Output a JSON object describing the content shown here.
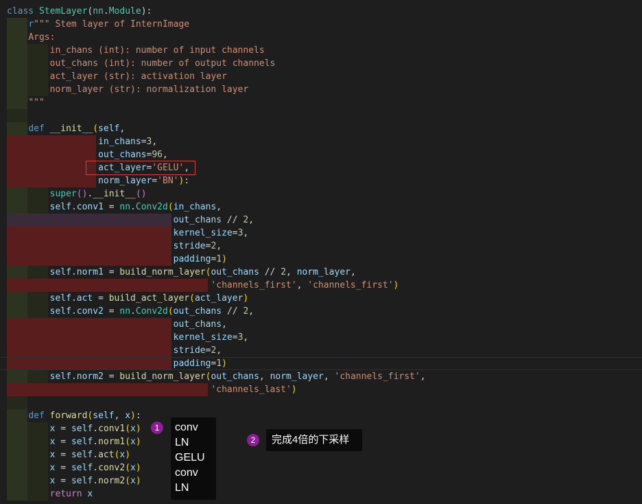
{
  "code": {
    "lines": [
      [
        [
          "tok-kw",
          "class "
        ],
        [
          "tok-cls",
          "StemLayer"
        ],
        [
          "tok-op",
          "("
        ],
        [
          "tok-cls",
          "nn"
        ],
        [
          "tok-op",
          "."
        ],
        [
          "tok-cls",
          "Module"
        ],
        [
          "tok-op",
          "):"
        ]
      ],
      [
        [
          "tok-sp",
          "    "
        ],
        [
          "tok-kw",
          "r"
        ],
        [
          "tok-str",
          "\"\"\" Stem layer of InternImage"
        ]
      ],
      [
        [
          "tok-sp",
          "    "
        ],
        [
          "tok-str",
          "Args:"
        ]
      ],
      [
        [
          "tok-sp",
          "        "
        ],
        [
          "tok-str",
          "in_chans (int): number of input channels"
        ]
      ],
      [
        [
          "tok-sp",
          "        "
        ],
        [
          "tok-str",
          "out_chans (int): number of output channels"
        ]
      ],
      [
        [
          "tok-sp",
          "        "
        ],
        [
          "tok-str",
          "act_layer (str): activation layer"
        ]
      ],
      [
        [
          "tok-sp",
          "        "
        ],
        [
          "tok-str",
          "norm_layer (str): normalization layer"
        ]
      ],
      [
        [
          "tok-sp",
          "    "
        ],
        [
          "tok-str",
          "\"\"\""
        ]
      ],
      [],
      [
        [
          "tok-sp",
          "    "
        ],
        [
          "tok-kw",
          "def "
        ],
        [
          "tok-fn",
          "__init__"
        ],
        [
          "tok-paren",
          "("
        ],
        [
          "tok-var",
          "self"
        ],
        [
          "tok-op",
          ","
        ]
      ],
      [
        [
          "tok-sp",
          "                 "
        ],
        [
          "tok-var",
          "in_chans"
        ],
        [
          "tok-op",
          "="
        ],
        [
          "tok-num",
          "3"
        ],
        [
          "tok-op",
          ","
        ]
      ],
      [
        [
          "tok-sp",
          "                 "
        ],
        [
          "tok-var",
          "out_chans"
        ],
        [
          "tok-op",
          "="
        ],
        [
          "tok-num",
          "96"
        ],
        [
          "tok-op",
          ","
        ]
      ],
      [
        [
          "tok-sp",
          "                 "
        ],
        [
          "tok-var",
          "act_layer"
        ],
        [
          "tok-op",
          "="
        ],
        [
          "tok-str",
          "'GELU'"
        ],
        [
          "tok-op",
          ","
        ]
      ],
      [
        [
          "tok-sp",
          "                 "
        ],
        [
          "tok-var",
          "norm_layer"
        ],
        [
          "tok-op",
          "="
        ],
        [
          "tok-str",
          "'BN'"
        ],
        [
          "tok-paren",
          ")"
        ],
        [
          "tok-op",
          ":"
        ]
      ],
      [
        [
          "tok-sp",
          "        "
        ],
        [
          "tok-cls",
          "super"
        ],
        [
          "tok-paren2",
          "()"
        ],
        [
          "tok-op",
          "."
        ],
        [
          "tok-fn",
          "__init__"
        ],
        [
          "tok-paren2",
          "()"
        ]
      ],
      [
        [
          "tok-sp",
          "        "
        ],
        [
          "tok-var",
          "self"
        ],
        [
          "tok-op",
          "."
        ],
        [
          "tok-var",
          "conv1"
        ],
        [
          "tok-op",
          " = "
        ],
        [
          "tok-cls",
          "nn"
        ],
        [
          "tok-op",
          "."
        ],
        [
          "tok-cls",
          "Conv2d"
        ],
        [
          "tok-paren",
          "("
        ],
        [
          "tok-var",
          "in_chans"
        ],
        [
          "tok-op",
          ","
        ]
      ],
      [
        [
          "tok-sp",
          "                               "
        ],
        [
          "tok-var",
          "out_chans"
        ],
        [
          "tok-op",
          " // "
        ],
        [
          "tok-num",
          "2"
        ],
        [
          "tok-op",
          ","
        ]
      ],
      [
        [
          "tok-sp",
          "                               "
        ],
        [
          "tok-var",
          "kernel_size"
        ],
        [
          "tok-op",
          "="
        ],
        [
          "tok-num",
          "3"
        ],
        [
          "tok-op",
          ","
        ]
      ],
      [
        [
          "tok-sp",
          "                               "
        ],
        [
          "tok-var",
          "stride"
        ],
        [
          "tok-op",
          "="
        ],
        [
          "tok-num",
          "2"
        ],
        [
          "tok-op",
          ","
        ]
      ],
      [
        [
          "tok-sp",
          "                               "
        ],
        [
          "tok-var",
          "padding"
        ],
        [
          "tok-op",
          "="
        ],
        [
          "tok-num",
          "1"
        ],
        [
          "tok-paren",
          ")"
        ]
      ],
      [
        [
          "tok-sp",
          "        "
        ],
        [
          "tok-var",
          "self"
        ],
        [
          "tok-op",
          "."
        ],
        [
          "tok-var",
          "norm1"
        ],
        [
          "tok-op",
          " = "
        ],
        [
          "tok-fn",
          "build_norm_layer"
        ],
        [
          "tok-paren",
          "("
        ],
        [
          "tok-var",
          "out_chans"
        ],
        [
          "tok-op",
          " // "
        ],
        [
          "tok-num",
          "2"
        ],
        [
          "tok-op",
          ", "
        ],
        [
          "tok-var",
          "norm_layer"
        ],
        [
          "tok-op",
          ","
        ]
      ],
      [
        [
          "tok-sp",
          "                                      "
        ],
        [
          "tok-str",
          "'channels_first'"
        ],
        [
          "tok-op",
          ", "
        ],
        [
          "tok-str",
          "'channels_first'"
        ],
        [
          "tok-paren",
          ")"
        ]
      ],
      [
        [
          "tok-sp",
          "        "
        ],
        [
          "tok-var",
          "self"
        ],
        [
          "tok-op",
          "."
        ],
        [
          "tok-var",
          "act"
        ],
        [
          "tok-op",
          " = "
        ],
        [
          "tok-fn",
          "build_act_layer"
        ],
        [
          "tok-paren",
          "("
        ],
        [
          "tok-var",
          "act_layer"
        ],
        [
          "tok-paren",
          ")"
        ]
      ],
      [
        [
          "tok-sp",
          "        "
        ],
        [
          "tok-var",
          "self"
        ],
        [
          "tok-op",
          "."
        ],
        [
          "tok-var",
          "conv2"
        ],
        [
          "tok-op",
          " = "
        ],
        [
          "tok-cls",
          "nn"
        ],
        [
          "tok-op",
          "."
        ],
        [
          "tok-cls",
          "Conv2d"
        ],
        [
          "tok-paren",
          "("
        ],
        [
          "tok-var",
          "out_chans"
        ],
        [
          "tok-op",
          " // "
        ],
        [
          "tok-num",
          "2"
        ],
        [
          "tok-op",
          ","
        ]
      ],
      [
        [
          "tok-sp",
          "                               "
        ],
        [
          "tok-var",
          "out_chans"
        ],
        [
          "tok-op",
          ","
        ]
      ],
      [
        [
          "tok-sp",
          "                               "
        ],
        [
          "tok-var",
          "kernel_size"
        ],
        [
          "tok-op",
          "="
        ],
        [
          "tok-num",
          "3"
        ],
        [
          "tok-op",
          ","
        ]
      ],
      [
        [
          "tok-sp",
          "                               "
        ],
        [
          "tok-var",
          "stride"
        ],
        [
          "tok-op",
          "="
        ],
        [
          "tok-num",
          "2"
        ],
        [
          "tok-op",
          ","
        ]
      ],
      [
        [
          "tok-sp",
          "                               "
        ],
        [
          "tok-var",
          "padding"
        ],
        [
          "tok-op",
          "="
        ],
        [
          "tok-num",
          "1"
        ],
        [
          "tok-paren",
          ")"
        ]
      ],
      [
        [
          "tok-sp",
          "        "
        ],
        [
          "tok-var",
          "self"
        ],
        [
          "tok-op",
          "."
        ],
        [
          "tok-var",
          "norm2"
        ],
        [
          "tok-op",
          " = "
        ],
        [
          "tok-fn",
          "build_norm_layer"
        ],
        [
          "tok-paren",
          "("
        ],
        [
          "tok-var",
          "out_chans"
        ],
        [
          "tok-op",
          ", "
        ],
        [
          "tok-var",
          "norm_layer"
        ],
        [
          "tok-op",
          ", "
        ],
        [
          "tok-str",
          "'channels_first'"
        ],
        [
          "tok-op",
          ","
        ]
      ],
      [
        [
          "tok-sp",
          "                                      "
        ],
        [
          "tok-str",
          "'channels_last'"
        ],
        [
          "tok-paren",
          ")"
        ]
      ],
      [],
      [
        [
          "tok-sp",
          "    "
        ],
        [
          "tok-kw",
          "def "
        ],
        [
          "tok-fn",
          "forward"
        ],
        [
          "tok-paren",
          "("
        ],
        [
          "tok-var",
          "self"
        ],
        [
          "tok-op",
          ", "
        ],
        [
          "tok-var",
          "x"
        ],
        [
          "tok-paren",
          ")"
        ],
        [
          "tok-op",
          ":"
        ]
      ],
      [
        [
          "tok-sp",
          "        "
        ],
        [
          "tok-var",
          "x"
        ],
        [
          "tok-op",
          " = "
        ],
        [
          "tok-var",
          "self"
        ],
        [
          "tok-op",
          "."
        ],
        [
          "tok-fn",
          "conv1"
        ],
        [
          "tok-paren",
          "("
        ],
        [
          "tok-var",
          "x"
        ],
        [
          "tok-paren",
          ")"
        ]
      ],
      [
        [
          "tok-sp",
          "        "
        ],
        [
          "tok-var",
          "x"
        ],
        [
          "tok-op",
          " = "
        ],
        [
          "tok-var",
          "self"
        ],
        [
          "tok-op",
          "."
        ],
        [
          "tok-fn",
          "norm1"
        ],
        [
          "tok-paren",
          "("
        ],
        [
          "tok-var",
          "x"
        ],
        [
          "tok-paren",
          ")"
        ]
      ],
      [
        [
          "tok-sp",
          "        "
        ],
        [
          "tok-var",
          "x"
        ],
        [
          "tok-op",
          " = "
        ],
        [
          "tok-var",
          "self"
        ],
        [
          "tok-op",
          "."
        ],
        [
          "tok-fn",
          "act"
        ],
        [
          "tok-paren",
          "("
        ],
        [
          "tok-var",
          "x"
        ],
        [
          "tok-paren",
          ")"
        ]
      ],
      [
        [
          "tok-sp",
          "        "
        ],
        [
          "tok-var",
          "x"
        ],
        [
          "tok-op",
          " = "
        ],
        [
          "tok-var",
          "self"
        ],
        [
          "tok-op",
          "."
        ],
        [
          "tok-fn",
          "conv2"
        ],
        [
          "tok-paren",
          "("
        ],
        [
          "tok-var",
          "x"
        ],
        [
          "tok-paren",
          ")"
        ]
      ],
      [
        [
          "tok-sp",
          "        "
        ],
        [
          "tok-var",
          "x"
        ],
        [
          "tok-op",
          " = "
        ],
        [
          "tok-var",
          "self"
        ],
        [
          "tok-op",
          "."
        ],
        [
          "tok-fn",
          "norm2"
        ],
        [
          "tok-paren",
          "("
        ],
        [
          "tok-var",
          "x"
        ],
        [
          "tok-paren",
          ")"
        ]
      ],
      [
        [
          "tok-sp",
          "        "
        ],
        [
          "tok-kw2",
          "return "
        ],
        [
          "tok-var",
          "x"
        ]
      ]
    ]
  },
  "annotations": {
    "badge_1": "1",
    "callout_1_items": [
      "conv",
      "LN",
      "GELU",
      "conv",
      "LN"
    ],
    "badge_2": "2",
    "callout_2_text": "完成4倍的下采样"
  },
  "colors": {
    "editor_background": "#1e1e1e",
    "indent_guide_olive": "#2c3320",
    "indent_guide_red": "#5a1d1d",
    "highlight_border": "#e03c3c",
    "badge_purple": "#8e1e93"
  }
}
